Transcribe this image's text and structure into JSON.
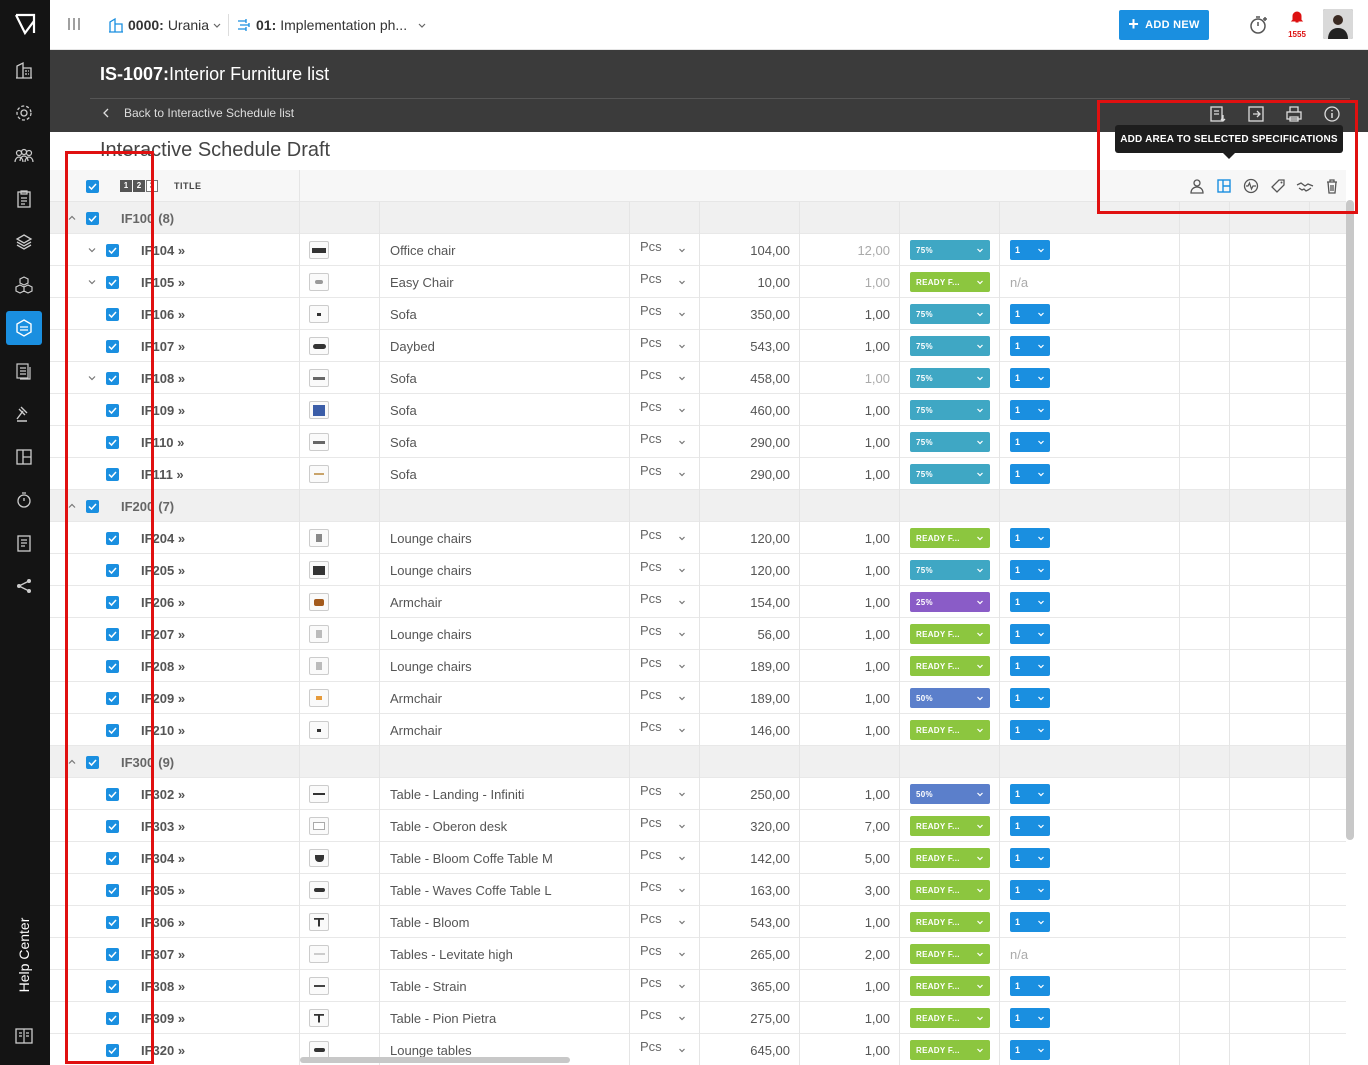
{
  "topbar": {
    "project_code": "0000:",
    "project_name": "Urania",
    "phase_code": "01:",
    "phase_name": "Implementation ph...",
    "add_new_label": "ADD NEW",
    "notification_count": "1555"
  },
  "header": {
    "code": "IS-1007:",
    "title": "Interior Furniture list",
    "back_label": "Back to Interactive Schedule list"
  },
  "draft_title": "Interactive Schedule Draft",
  "tooltip": "ADD AREA TO SELECTED SPECIFICATIONS",
  "table_header": {
    "levels": [
      "1",
      "2",
      "3"
    ],
    "title_label": "TITLE"
  },
  "sidebar": {
    "help_label": "Help Center"
  },
  "colors": {
    "accent": "#1a8fe0",
    "status_75": "#3fa7c4",
    "status_ready": "#8cc63f",
    "status_25": "#8a5cc7",
    "status_50": "#5b7fcb",
    "highlight": "#e01010"
  },
  "rows": [
    {
      "type": "group",
      "code": "IF100",
      "count": "(8)"
    },
    {
      "type": "item",
      "chev": true,
      "code": "IF104 »",
      "name": "Office chair",
      "unit": "Pcs",
      "qty": "104,00",
      "qty2": "12,00",
      "qty2_faded": true,
      "status": "75%",
      "status_color": "#3fa7c4",
      "ver": "1",
      "thumb": "chair1"
    },
    {
      "type": "item",
      "chev": true,
      "code": "IF105 »",
      "name": "Easy Chair",
      "unit": "Pcs",
      "qty": "10,00",
      "qty2": "1,00",
      "qty2_faded": true,
      "status": "READY F...",
      "status_color": "#8cc63f",
      "ver": "n/a",
      "thumb": "chair2"
    },
    {
      "type": "item",
      "chev": false,
      "code": "IF106 »",
      "name": "Sofa",
      "unit": "Pcs",
      "qty": "350,00",
      "qty2": "1,00",
      "qty2_faded": false,
      "status": "75%",
      "status_color": "#3fa7c4",
      "ver": "1",
      "thumb": "dot"
    },
    {
      "type": "item",
      "chev": false,
      "code": "IF107 »",
      "name": "Daybed",
      "unit": "Pcs",
      "qty": "543,00",
      "qty2": "1,00",
      "qty2_faded": false,
      "status": "75%",
      "status_color": "#3fa7c4",
      "ver": "1",
      "thumb": "bed"
    },
    {
      "type": "item",
      "chev": true,
      "code": "IF108 »",
      "name": "Sofa",
      "unit": "Pcs",
      "qty": "458,00",
      "qty2": "1,00",
      "qty2_faded": true,
      "status": "75%",
      "status_color": "#3fa7c4",
      "ver": "1",
      "thumb": "sofa"
    },
    {
      "type": "item",
      "chev": false,
      "code": "IF109 »",
      "name": "Sofa",
      "unit": "Pcs",
      "qty": "460,00",
      "qty2": "1,00",
      "qty2_faded": false,
      "status": "75%",
      "status_color": "#3fa7c4",
      "ver": "1",
      "thumb": "photo"
    },
    {
      "type": "item",
      "chev": false,
      "code": "IF110 »",
      "name": "Sofa",
      "unit": "Pcs",
      "qty": "290,00",
      "qty2": "1,00",
      "qty2_faded": false,
      "status": "75%",
      "status_color": "#3fa7c4",
      "ver": "1",
      "thumb": "sofa"
    },
    {
      "type": "item",
      "chev": false,
      "code": "IF111 »",
      "name": "Sofa",
      "unit": "Pcs",
      "qty": "290,00",
      "qty2": "1,00",
      "qty2_faded": false,
      "status": "75%",
      "status_color": "#3fa7c4",
      "ver": "1",
      "thumb": "sofa2"
    },
    {
      "type": "group",
      "code": "IF200",
      "count": "(7)"
    },
    {
      "type": "item",
      "chev": false,
      "code": "IF204 »",
      "name": "Lounge chairs",
      "unit": "Pcs",
      "qty": "120,00",
      "qty2": "1,00",
      "qty2_faded": false,
      "status": "READY F...",
      "status_color": "#8cc63f",
      "ver": "1",
      "thumb": "lounge"
    },
    {
      "type": "item",
      "chev": false,
      "code": "IF205 »",
      "name": "Lounge chairs",
      "unit": "Pcs",
      "qty": "120,00",
      "qty2": "1,00",
      "qty2_faded": false,
      "status": "75%",
      "status_color": "#3fa7c4",
      "ver": "1",
      "thumb": "lounge2"
    },
    {
      "type": "item",
      "chev": false,
      "code": "IF206 »",
      "name": "Armchair",
      "unit": "Pcs",
      "qty": "154,00",
      "qty2": "1,00",
      "qty2_faded": false,
      "status": "25%",
      "status_color": "#8a5cc7",
      "ver": "1",
      "thumb": "arm"
    },
    {
      "type": "item",
      "chev": false,
      "code": "IF207 »",
      "name": "Lounge chairs",
      "unit": "Pcs",
      "qty": "56,00",
      "qty2": "1,00",
      "qty2_faded": false,
      "status": "READY F...",
      "status_color": "#8cc63f",
      "ver": "1",
      "thumb": "lounge3"
    },
    {
      "type": "item",
      "chev": false,
      "code": "IF208 »",
      "name": "Lounge chairs",
      "unit": "Pcs",
      "qty": "189,00",
      "qty2": "1,00",
      "qty2_faded": false,
      "status": "READY F...",
      "status_color": "#8cc63f",
      "ver": "1",
      "thumb": "lounge3"
    },
    {
      "type": "item",
      "chev": false,
      "code": "IF209 »",
      "name": "Armchair",
      "unit": "Pcs",
      "qty": "189,00",
      "qty2": "1,00",
      "qty2_faded": false,
      "status": "50%",
      "status_color": "#5b7fcb",
      "ver": "1",
      "thumb": "arm2"
    },
    {
      "type": "item",
      "chev": false,
      "code": "IF210 »",
      "name": "Armchair",
      "unit": "Pcs",
      "qty": "146,00",
      "qty2": "1,00",
      "qty2_faded": false,
      "status": "READY F...",
      "status_color": "#8cc63f",
      "ver": "1",
      "thumb": "dot"
    },
    {
      "type": "group",
      "code": "IF300",
      "count": "(9)"
    },
    {
      "type": "item",
      "chev": false,
      "code": "IF302 »",
      "name": "Table - Landing - Infiniti",
      "unit": "Pcs",
      "qty": "250,00",
      "qty2": "1,00",
      "qty2_faded": false,
      "status": "50%",
      "status_color": "#5b7fcb",
      "ver": "1",
      "thumb": "table"
    },
    {
      "type": "item",
      "chev": false,
      "code": "IF303 »",
      "name": "Table - Oberon desk",
      "unit": "Pcs",
      "qty": "320,00",
      "qty2": "7,00",
      "qty2_faded": false,
      "status": "READY F...",
      "status_color": "#8cc63f",
      "ver": "1",
      "thumb": "desk"
    },
    {
      "type": "item",
      "chev": false,
      "code": "IF304 »",
      "name": "Table - Bloom Coffe Table M",
      "unit": "Pcs",
      "qty": "142,00",
      "qty2": "5,00",
      "qty2_faded": false,
      "status": "READY F...",
      "status_color": "#8cc63f",
      "ver": "1",
      "thumb": "bowl"
    },
    {
      "type": "item",
      "chev": false,
      "code": "IF305 »",
      "name": "Table - Waves Coffe Table L",
      "unit": "Pcs",
      "qty": "163,00",
      "qty2": "3,00",
      "qty2_faded": false,
      "status": "READY F...",
      "status_color": "#8cc63f",
      "ver": "1",
      "thumb": "bowl2"
    },
    {
      "type": "item",
      "chev": false,
      "code": "IF306 »",
      "name": "Table - Bloom",
      "unit": "Pcs",
      "qty": "543,00",
      "qty2": "1,00",
      "qty2_faded": false,
      "status": "READY F...",
      "status_color": "#8cc63f",
      "ver": "1",
      "thumb": "tee"
    },
    {
      "type": "item",
      "chev": false,
      "code": "IF307 »",
      "name": "Tables - Levitate high",
      "unit": "Pcs",
      "qty": "265,00",
      "qty2": "2,00",
      "qty2_faded": false,
      "status": "READY F...",
      "status_color": "#8cc63f",
      "ver": "n/a",
      "thumb": "light"
    },
    {
      "type": "item",
      "chev": false,
      "code": "IF308 »",
      "name": "Table - Strain",
      "unit": "Pcs",
      "qty": "365,00",
      "qty2": "1,00",
      "qty2_faded": false,
      "status": "READY F...",
      "status_color": "#8cc63f",
      "ver": "1",
      "thumb": "table2"
    },
    {
      "type": "item",
      "chev": false,
      "code": "IF309 »",
      "name": "Table - Pion Pietra",
      "unit": "Pcs",
      "qty": "275,00",
      "qty2": "1,00",
      "qty2_faded": false,
      "status": "READY F...",
      "status_color": "#8cc63f",
      "ver": "1",
      "thumb": "tee"
    },
    {
      "type": "item",
      "chev": false,
      "code": "IF320 »",
      "name": "Lounge tables",
      "unit": "Pcs",
      "qty": "645,00",
      "qty2": "1,00",
      "qty2_faded": false,
      "status": "READY F...",
      "status_color": "#8cc63f",
      "ver": "1",
      "thumb": "bowl2"
    }
  ]
}
